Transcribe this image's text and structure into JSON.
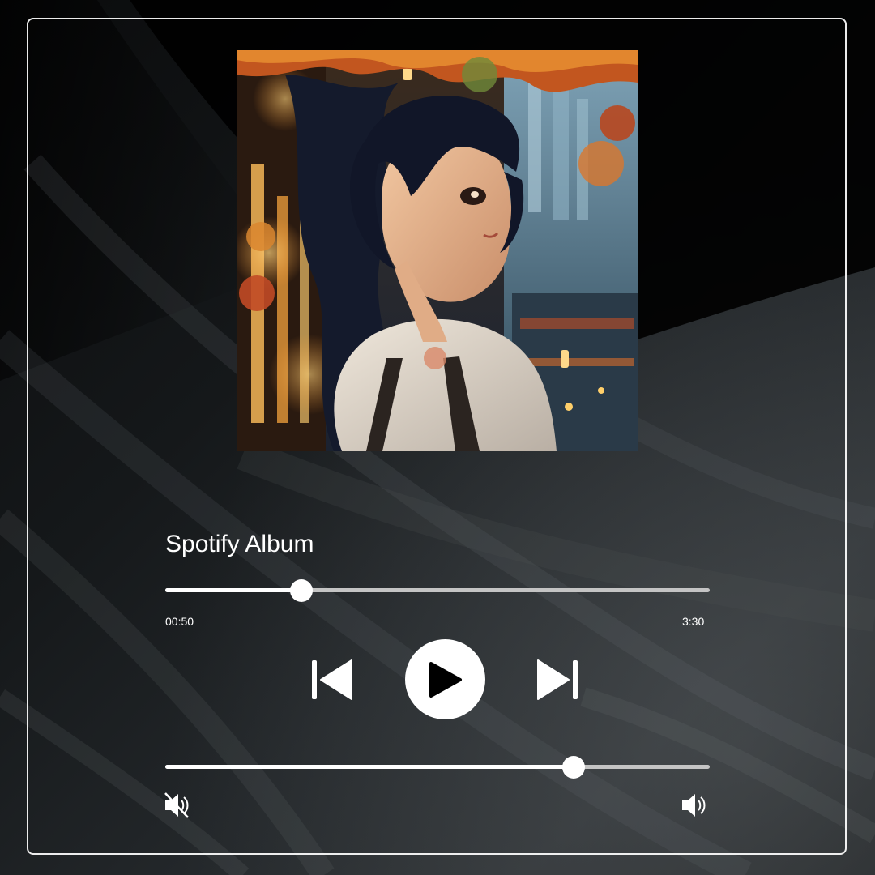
{
  "player": {
    "album_title": "Spotify Album",
    "elapsed_time": "00:50",
    "total_time": "3:30",
    "progress_fraction": 0.25,
    "volume_fraction": 0.75
  },
  "controls": {
    "previous_icon": "skip-previous-icon",
    "play_icon": "play-icon",
    "next_icon": "skip-next-icon",
    "mute_icon": "volume-mute-icon",
    "volume_icon": "volume-up-icon"
  },
  "colors": {
    "foreground": "#ffffff",
    "track": "#c4c4c4",
    "background": "#1a1d1f"
  }
}
